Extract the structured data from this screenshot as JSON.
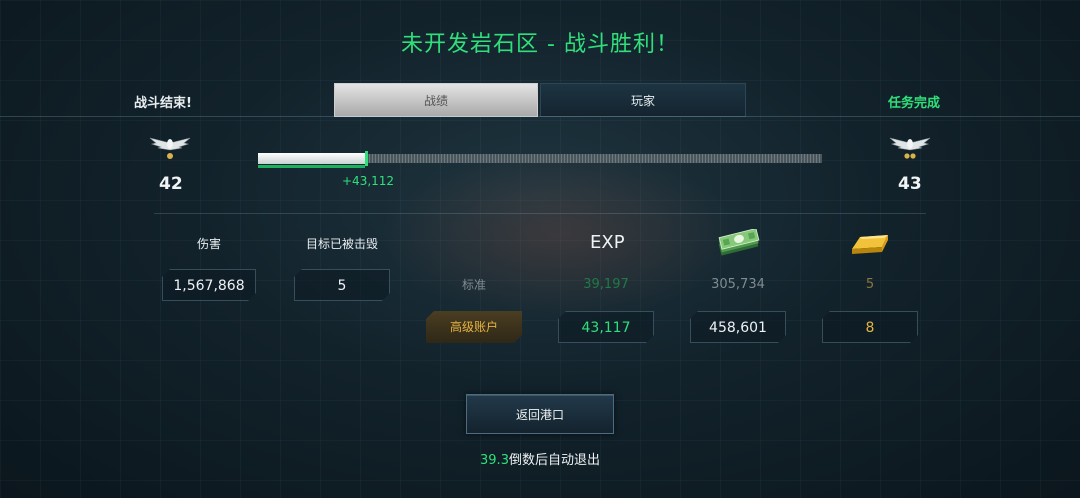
{
  "header": {
    "title": "未开发岩石区 - 战斗胜利！",
    "battle_status": "战斗结束!",
    "mission_status": "任务完成"
  },
  "tabs": [
    {
      "label": "战绩",
      "active": true
    },
    {
      "label": "玩家",
      "active": false
    }
  ],
  "progress": {
    "level_current": "42",
    "level_next": "43",
    "xp_gain": "+43,112",
    "fill_fraction": 0.19
  },
  "stats": {
    "damage_label": "伤害",
    "damage_value": "1,567,868",
    "destroyed_label": "目标已被击毁",
    "destroyed_value": "5"
  },
  "rewards": {
    "exp_header": "EXP",
    "money_icon": "money-stack-icon",
    "gold_icon": "gold-bar-icon",
    "standard_label": "标准",
    "standard": {
      "exp": "39,197",
      "credits": "305,734",
      "gold": "5"
    },
    "premium_label": "高级账户",
    "premium": {
      "exp": "43,117",
      "credits": "458,601",
      "gold": "8"
    }
  },
  "footer": {
    "return_button": "返回港口",
    "countdown_seconds": "39.3",
    "countdown_text": "倒数后自动退出"
  },
  "colors": {
    "accent_green": "#2fe07a",
    "gold_text": "#e6b341",
    "dim_gold": "#8a7640",
    "dim_text": "#7f8b90"
  }
}
